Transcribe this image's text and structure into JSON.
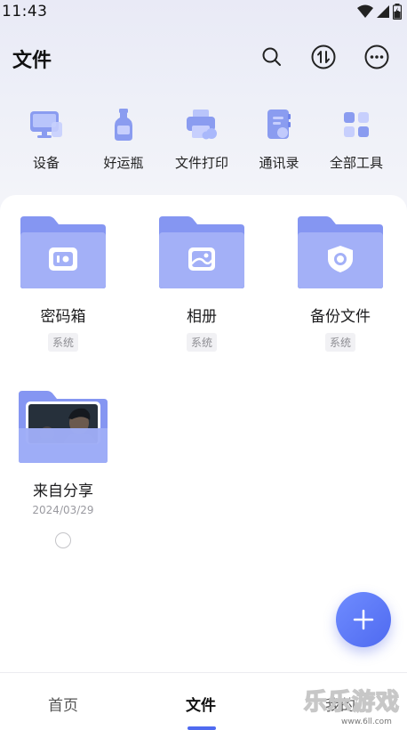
{
  "status_bar": {
    "time": "11:43",
    "icons": [
      "wifi-icon",
      "signal-icon",
      "battery-charging-icon"
    ]
  },
  "header": {
    "title": "文件",
    "actions": [
      "search-icon",
      "transfer-icon",
      "more-icon"
    ]
  },
  "tools": [
    {
      "label": "设备",
      "icon": "device-icon"
    },
    {
      "label": "好运瓶",
      "icon": "bottle-icon"
    },
    {
      "label": "文件打印",
      "icon": "printer-icon"
    },
    {
      "label": "通讯录",
      "icon": "contacts-icon"
    },
    {
      "label": "全部工具",
      "icon": "grid-icon"
    }
  ],
  "folders": [
    {
      "name": "密码箱",
      "badge": "系统",
      "icon": "safe-icon"
    },
    {
      "name": "相册",
      "badge": "系统",
      "icon": "photo-icon"
    },
    {
      "name": "备份文件",
      "badge": "系统",
      "icon": "shield-icon"
    },
    {
      "name": "来自分享",
      "date": "2024/03/29",
      "icon": "shared-image-thumbnail"
    }
  ],
  "fab": {
    "icon": "plus-icon"
  },
  "bottom_nav": {
    "tabs": [
      {
        "label": "首页",
        "active": false
      },
      {
        "label": "文件",
        "active": true
      },
      {
        "label": "我的",
        "active": false
      }
    ]
  },
  "watermark": {
    "main": "乐乐游戏",
    "url": "www.6ll.com"
  },
  "colors": {
    "accent": "#4f6af0",
    "folder": "#8f9ef5"
  }
}
